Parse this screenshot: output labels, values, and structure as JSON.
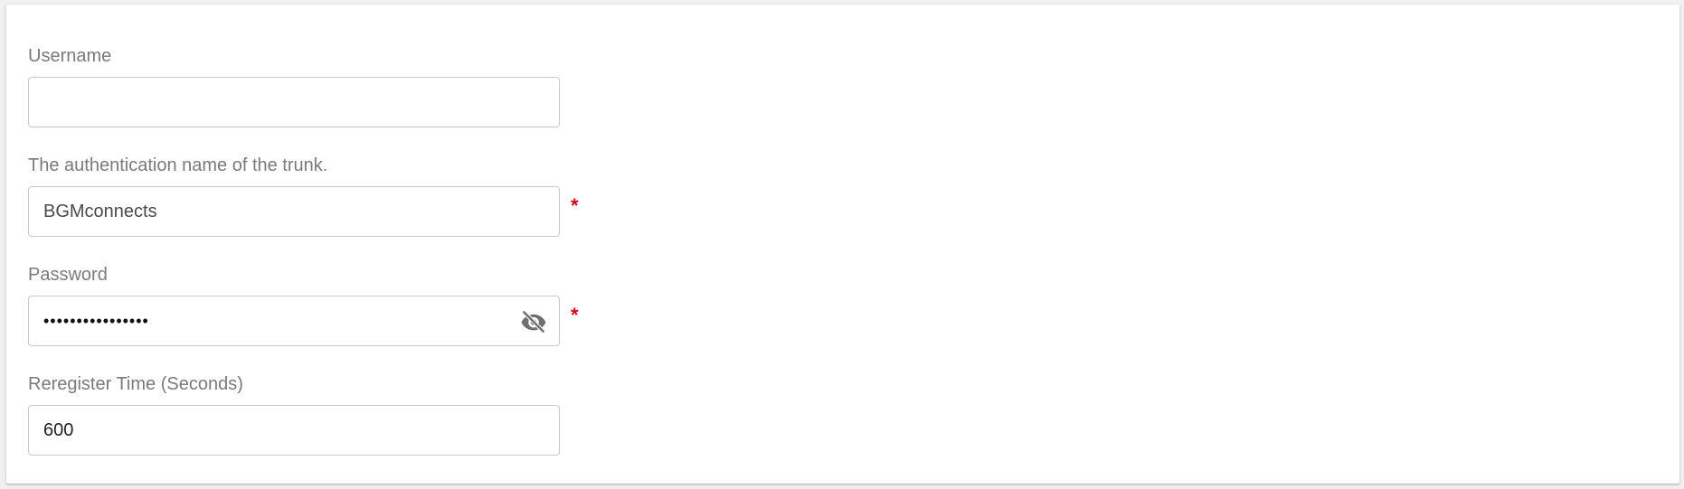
{
  "colors": {
    "required": "#d9001b",
    "label": "#7a7a7a",
    "border": "#c9c9c9",
    "icon": "#6f6f6f"
  },
  "fields": {
    "username": {
      "label": "Username",
      "value": "",
      "placeholder": ""
    },
    "auth_name": {
      "label": "The authentication name of the trunk.",
      "value": "BGMconnects",
      "required_mark": "*"
    },
    "password": {
      "label": "Password",
      "value": "••••••••••••••••",
      "required_mark": "*",
      "toggle_icon": "eye-off-icon"
    },
    "reregister_time": {
      "label": "Reregister Time (Seconds)",
      "value": "600"
    }
  }
}
